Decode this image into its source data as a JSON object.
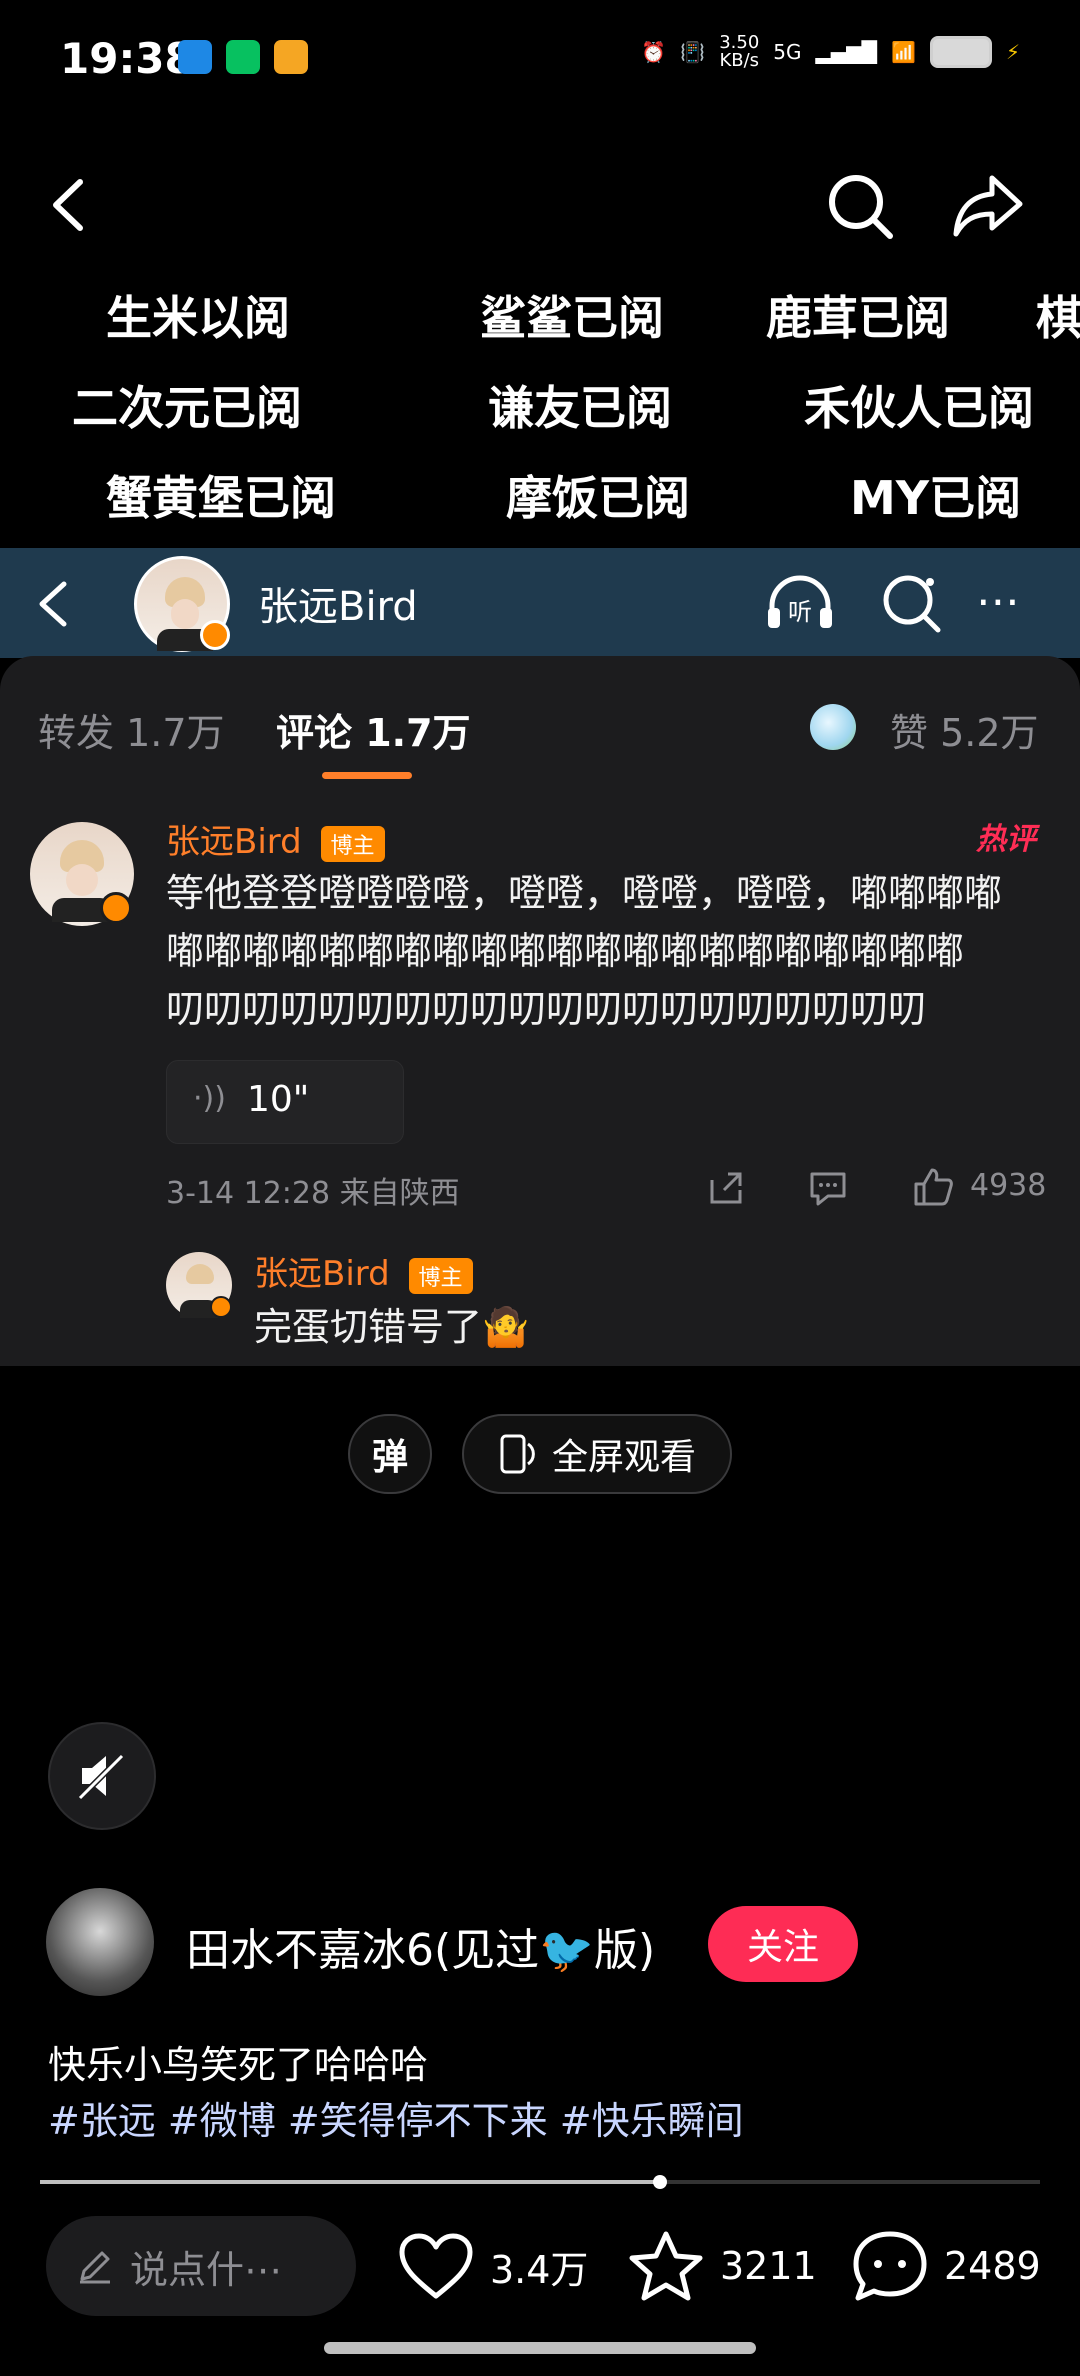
{
  "status_bar": {
    "time": "19:38",
    "net_speed": "3.50\nKB/s",
    "network": "5G",
    "colors": {
      "nfc": "#1e88e5",
      "wechat": "#07c160",
      "weibo": "#f5a623"
    }
  },
  "topbar": {
    "icons": [
      "back-icon",
      "search-icon",
      "share-icon"
    ],
    "overlay_rows": [
      [
        "生米以阅",
        "鲨鲨已阅",
        "鹿茸已阅",
        "棋"
      ],
      [
        "二次元已阅",
        "谦友已阅",
        "禾伙人已阅"
      ],
      [
        "蟹黄堡已阅",
        "摩饭已阅",
        "MY已阅"
      ]
    ]
  },
  "weibo_card": {
    "user_name": "张远Bird",
    "tabs": {
      "repost": "转发 1.7万",
      "comment": "评论 1.7万",
      "like": "赞 5.2万"
    },
    "comment": {
      "author": "张远Bird",
      "badge": "博主",
      "hot_label": "热评",
      "lines": [
        "等他登登噔噔噔噔，噔噔，噔噔，噔噔，嘟嘟嘟嘟",
        "嘟嘟嘟嘟嘟嘟嘟嘟嘟嘟嘟嘟嘟嘟嘟嘟嘟嘟嘟嘟嘟",
        "叨叨叨叨叨叨叨叨叨叨叨叨叨叨叨叨叨叨叨叨"
      ],
      "voice_duration": "10\"",
      "time_location": "3-14 12:28  来自陕西",
      "likes": "4938"
    },
    "reply": {
      "author": "张远Bird",
      "badge": "博主",
      "text": "完蛋切错号了🤷"
    }
  },
  "player_controls": {
    "danmaku_label": "弹",
    "fullscreen_label": "全屏观看"
  },
  "poster": {
    "name": "田水不嘉冰6(见过🐦版)",
    "follow_label": "关注",
    "follow_color": "#fe2c55",
    "caption": "快乐小鸟笑死了哈哈哈",
    "hashtags": "#张远 #微博 #笑得停不下来 #快乐瞬间"
  },
  "progress": {
    "played_fraction": 0.62
  },
  "bottom_bar": {
    "comment_placeholder": "说点什⋯",
    "likes": "3.4万",
    "favorites": "3211",
    "comments": "2489"
  }
}
